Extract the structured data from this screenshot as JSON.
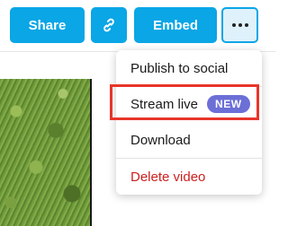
{
  "toolbar": {
    "share_label": "Share",
    "copy_link_icon": "link-icon",
    "embed_label": "Embed",
    "more_icon": "more-horizontal-icon"
  },
  "menu": {
    "items": [
      {
        "label": "Publish to social"
      },
      {
        "label": "Stream live",
        "badge": "NEW"
      },
      {
        "label": "Download"
      },
      {
        "label": "Delete video",
        "destructive": true
      }
    ]
  },
  "colors": {
    "accent": "#0aa6e6",
    "badge": "#6b6fd6",
    "danger": "#cc1f1f",
    "highlight": "#e8352a"
  }
}
